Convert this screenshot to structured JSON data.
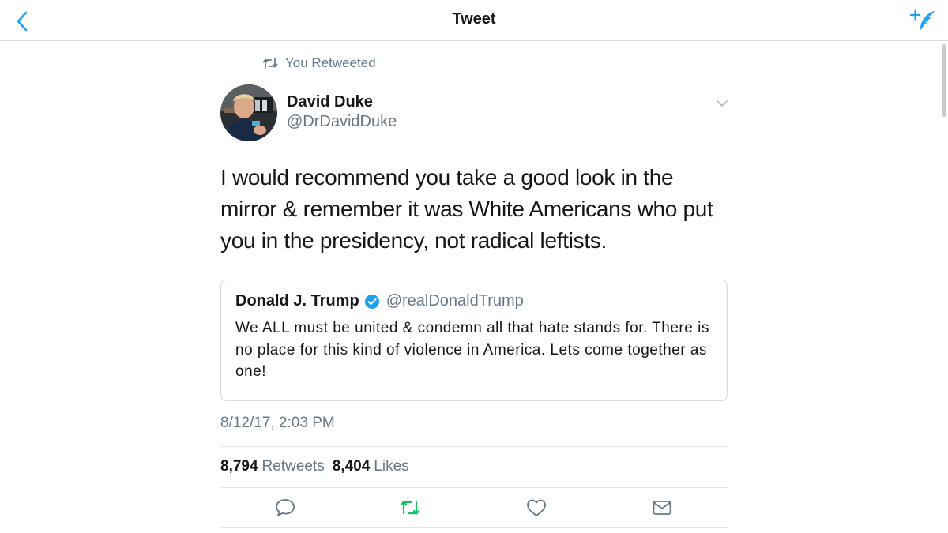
{
  "nav": {
    "title": "Tweet",
    "back_icon": "chevron-left-icon",
    "compose_icon": "compose-tweet-icon"
  },
  "retweet_context": {
    "label": "You Retweeted",
    "icon": "retweet-icon"
  },
  "tweet": {
    "author_name": "David Duke",
    "author_handle": "@DrDavidDuke",
    "text": "I would recommend you take a good look in the mirror & remember it was White Americans who put you in the presidency, not radical leftists.",
    "timestamp": "8/12/17, 2:03 PM",
    "retweets": "8,794",
    "retweets_label": "Retweets",
    "likes": "8,404",
    "likes_label": "Likes"
  },
  "quoted_tweet": {
    "author_name": "Donald J. Trump",
    "author_handle": "@realDonaldTrump",
    "verified": true,
    "text": "We ALL must be united & condemn all that hate stands for. There is no place for this kind of violence in America. Lets come together as one!"
  },
  "actions": {
    "reply_icon": "reply-icon",
    "retweet_icon": "retweet-icon",
    "like_icon": "heart-icon",
    "message_icon": "envelope-icon",
    "retweet_active": true
  },
  "colors": {
    "accent_blue": "#1da1f2",
    "retweet_green": "#17bf63",
    "text_primary": "#14171a",
    "text_secondary": "#657786",
    "border": "#e1e8ed"
  }
}
